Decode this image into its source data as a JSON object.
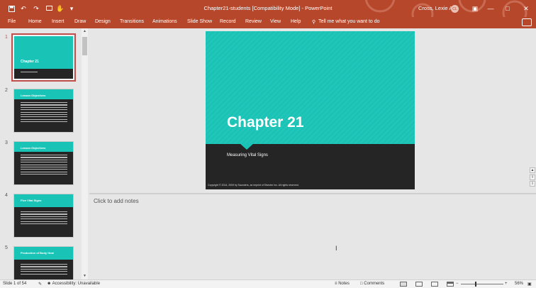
{
  "window": {
    "title": "Chapter21-students [Compatibility Mode] - PowerPoint",
    "user_name": "Cross, Lexie A",
    "user_initials": "CL",
    "controls": [
      "—",
      "□",
      "✕"
    ]
  },
  "quick_access": {
    "icons": [
      "save-icon",
      "undo-icon",
      "redo-icon",
      "start-from-beginning-icon",
      "touch-mode-icon",
      "customize-icon"
    ]
  },
  "ribbon": {
    "tabs": [
      "File",
      "Home",
      "Insert",
      "Draw",
      "Design",
      "Transitions",
      "Animations",
      "Slide Show",
      "Record",
      "Review",
      "View",
      "Help"
    ],
    "tell_me": "Tell me what you want to do"
  },
  "thumbnails": [
    {
      "number": "1",
      "title": "Chapter 21",
      "active": true
    },
    {
      "number": "2",
      "title": "Lesson Objectives",
      "active": false
    },
    {
      "number": "3",
      "title": "Lesson Objectives",
      "active": false
    },
    {
      "number": "4",
      "title": "Five Vital Signs",
      "active": false
    },
    {
      "number": "5",
      "title": "Production of Body Heat",
      "active": false
    }
  ],
  "slide": {
    "title": "Chapter 21",
    "subtitle": "Measuring Vital Signs",
    "copyright": "Copyright © 2014, 2009 by Saunders, an imprint of Elsevier Inc. All rights reserved."
  },
  "notes": {
    "placeholder": "Click to add notes"
  },
  "status": {
    "slide_count": "Slide 1 of 54",
    "accessibility": "Accessibility: Unavailable",
    "notes_label": "Notes",
    "comments_label": "Comments",
    "zoom": "56%"
  },
  "colors": {
    "accent": "#b7472a",
    "slide_teal": "#19c3b5",
    "slide_dark": "#252525"
  }
}
